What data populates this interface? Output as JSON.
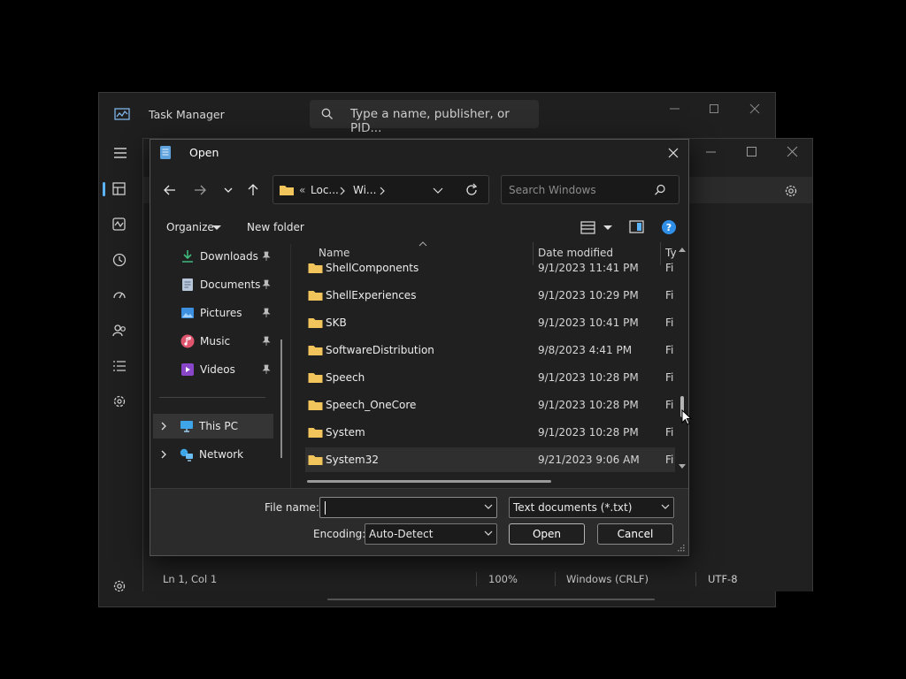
{
  "task_manager": {
    "title": "Task Manager",
    "search_placeholder": "Type a name, publisher, or PID..."
  },
  "notepad": {
    "status": {
      "position": "Ln 1, Col 1",
      "zoom": "100%",
      "line_ending": "Windows (CRLF)",
      "encoding": "UTF-8"
    }
  },
  "dialog": {
    "title": "Open",
    "breadcrumb": {
      "overflow": "«",
      "items": [
        "Loc...",
        "Wi..."
      ]
    },
    "search_placeholder": "Search Windows",
    "toolbar": {
      "organize": "Organize",
      "new_folder": "New folder"
    },
    "nav": [
      {
        "label": "Downloads",
        "icon": "downloads-icon"
      },
      {
        "label": "Documents",
        "icon": "documents-icon"
      },
      {
        "label": "Pictures",
        "icon": "pictures-icon"
      },
      {
        "label": "Music",
        "icon": "music-icon"
      },
      {
        "label": "Videos",
        "icon": "videos-icon"
      },
      {
        "label": "This PC",
        "icon": "this-pc-icon"
      },
      {
        "label": "Network",
        "icon": "network-icon"
      }
    ],
    "columns": {
      "name": "Name",
      "date": "Date modified",
      "type": "Ty"
    },
    "files": [
      {
        "name": "ShellComponents",
        "date": "9/1/2023 11:41 PM",
        "type": "Fi"
      },
      {
        "name": "ShellExperiences",
        "date": "9/1/2023 10:29 PM",
        "type": "Fi"
      },
      {
        "name": "SKB",
        "date": "9/1/2023 10:41 PM",
        "type": "Fi"
      },
      {
        "name": "SoftwareDistribution",
        "date": "9/8/2023 4:41 PM",
        "type": "Fi"
      },
      {
        "name": "Speech",
        "date": "9/1/2023 10:28 PM",
        "type": "Fi"
      },
      {
        "name": "Speech_OneCore",
        "date": "9/1/2023 10:28 PM",
        "type": "Fi"
      },
      {
        "name": "System",
        "date": "9/1/2023 10:28 PM",
        "type": "Fi"
      },
      {
        "name": "System32",
        "date": "9/21/2023 9:06 AM",
        "type": "Fi"
      }
    ],
    "footer": {
      "file_name_label": "File name:",
      "file_name_value": "",
      "file_type": "Text documents (*.txt)",
      "encoding_label": "Encoding:",
      "encoding_value": "Auto-Detect",
      "open": "Open",
      "cancel": "Cancel"
    }
  },
  "colors": {
    "accent": "#5cb3ff",
    "folder": "#f2c55c",
    "help": "#2f8fe8"
  }
}
